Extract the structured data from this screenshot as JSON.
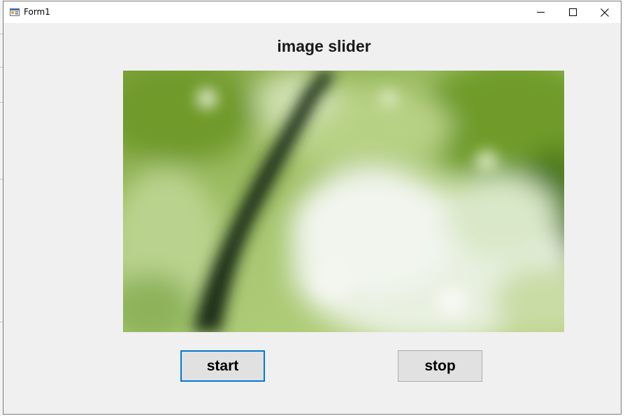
{
  "window": {
    "title": "Form1",
    "minimize_icon": "minimize-icon",
    "maximize_icon": "maximize-icon",
    "close_icon": "close-icon"
  },
  "form": {
    "heading": "image slider",
    "picture": "blurred-green-foliage-image",
    "start_label": "start",
    "stop_label": "stop",
    "focused_button": "start",
    "colors": {
      "form_background": "#f0f0f0",
      "button_background": "#e1e1e1",
      "focus_border": "#0078d7"
    }
  }
}
